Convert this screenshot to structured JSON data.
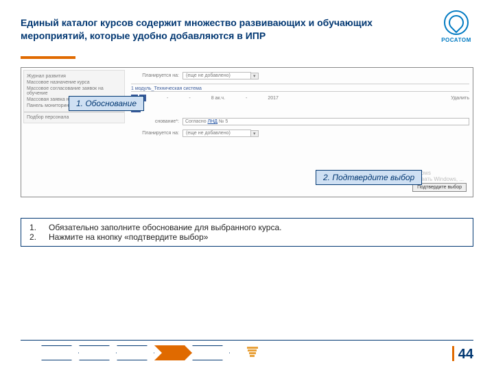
{
  "header": {
    "title": "Единый каталог курсов содержит множество развивающих и обучающих мероприятий, которые удобно добавляются в ИПР",
    "logo_text": "РОСАТОМ"
  },
  "sidebar": {
    "items": [
      "Журнал развития",
      "Массовое назначение курса",
      "Массовое согласование заявок на обучение",
      "Массовая заявка на обучение",
      "Панель мониторинга"
    ],
    "separated": "Подбор персонала"
  },
  "form": {
    "plan_label": "Планируется на:",
    "plan_value": "(еще не добавлено)",
    "module_title": "1 модуль_Техническая система",
    "hours": "8 ак.ч.",
    "year": "2017",
    "delete": "Удалить",
    "justif_label": "снование*:",
    "justif_value_pre": "Согласно ",
    "justif_link": "ЛНД",
    "justif_value_post": " № 5",
    "confirm_btn": "Подтвердите выбор",
    "wm1": "Активация Windows",
    "wm2": "Чтобы активировать Windows, ..."
  },
  "callouts": {
    "c1": "1. Обоснование",
    "c2": "2. Подтвердите выбор"
  },
  "instructions": {
    "i1_num": "1.",
    "i1_text": "Обязательно заполните обоснование для выбранного курса.",
    "i2_num": "2.",
    "i2_text": "Нажмите на кнопку «подтвердите выбор»"
  },
  "page_number": "44"
}
